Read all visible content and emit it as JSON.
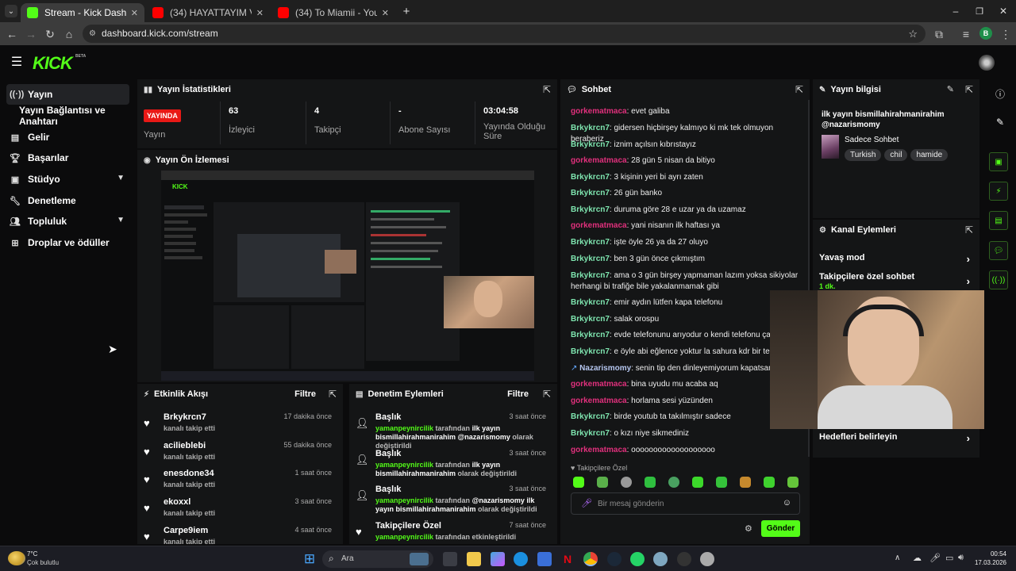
{
  "browser": {
    "tabs": [
      {
        "title": "Stream - Kick Dashboard",
        "fav_color": "#53fc18"
      },
      {
        "title": "(34) HAYATTAYIM VLOG - YouTu",
        "fav_color": "#ff0000"
      },
      {
        "title": "(34) To Miamii - YouTube",
        "fav_color": "#ff0000"
      }
    ],
    "url": "dashboard.kick.com/stream",
    "profile_initial": "B"
  },
  "brand": {
    "logo": "KICK",
    "badge": "BETA"
  },
  "sidebar": {
    "items": [
      {
        "label": "Yayın",
        "icon": "broadcast-icon"
      },
      {
        "label": "Yayın Bağlantısı ve Anahtarı",
        "icon": ""
      },
      {
        "label": "Gelir",
        "icon": "chart-icon"
      },
      {
        "label": "Başarılar",
        "icon": "trophy-icon"
      },
      {
        "label": "Stüdyo",
        "icon": "video-icon"
      },
      {
        "label": "Denetleme",
        "icon": "wrench-icon"
      },
      {
        "label": "Topluluk",
        "icon": "people-icon"
      },
      {
        "label": "Droplar ve ödüller",
        "icon": "gift-icon"
      }
    ]
  },
  "stats": {
    "title": "Yayın İstatistikleri",
    "live_badge": "YAYINDA",
    "live_label": "Yayın",
    "items": [
      {
        "value": "63",
        "label": "İzleyici"
      },
      {
        "value": "4",
        "label": "Takipçi"
      },
      {
        "value": "-",
        "label": "Abone Sayısı"
      },
      {
        "value": "03:04:58",
        "label": "Yayında Olduğu Süre"
      }
    ]
  },
  "preview": {
    "title": "Yayın Ön İzlemesi"
  },
  "activity": {
    "title": "Etkinlik Akışı",
    "filter": "Filtre",
    "items": [
      {
        "name": "Brkykrcn7",
        "sub": "kanalı takip etti",
        "time": "17 dakika önce"
      },
      {
        "name": "acilieblebi",
        "sub": "kanalı takip etti",
        "time": "55 dakika önce"
      },
      {
        "name": "enesdone34",
        "sub": "kanalı takip etti",
        "time": "1 saat önce"
      },
      {
        "name": "ekoxxl",
        "sub": "kanalı takip etti",
        "time": "3 saat önce"
      },
      {
        "name": "Carpe9iem",
        "sub": "kanalı takip etti",
        "time": "4 saat önce"
      }
    ]
  },
  "moderation": {
    "title": "Denetim Eylemleri",
    "filter": "Filtre",
    "items": [
      {
        "name": "Başlık",
        "actor": "yamanpeynircilik",
        "mid": " tarafından ",
        "text": "ilk yayın bismillahirahmanirahim @nazarismomy",
        "end": " olarak değiştirildi",
        "time": "3 saat önce"
      },
      {
        "name": "Başlık",
        "actor": "yamanpeynircilik",
        "mid": " tarafından ",
        "text": "ilk yayın bismillahirahmanirahim",
        "end": " olarak değiştirildi",
        "time": "3 saat önce"
      },
      {
        "name": "Başlık",
        "actor": "yamanpeynircilik",
        "mid": " tarafından ",
        "text": "@nazarismomy ilk yayın bismillahirahmanirahim",
        "end": " olarak değiştirildi",
        "time": "3 saat önce"
      },
      {
        "name": "Takipçilere Özel",
        "actor": "yamanpeynircilik",
        "mid": " tarafından etkinleştirildi",
        "text": "",
        "end": "",
        "time": "7 saat önce"
      }
    ]
  },
  "chat": {
    "title": "Sohbet",
    "messages": [
      {
        "user": "gorkematmaca",
        "ucls": "u2",
        "text": "evet galiba"
      },
      {
        "user": "Brkykrcn7",
        "ucls": "u1",
        "text": "gidersen hiçbirşey kalmıyo ki mk tek olmuyon beraberiz"
      },
      {
        "user": "Brkykrcn7",
        "ucls": "u1",
        "text": "iznim açılsın kıbrıstayız"
      },
      {
        "user": "gorkematmaca",
        "ucls": "u2",
        "text": "28 gün 5 nisan da bitiyo"
      },
      {
        "user": "Brkykrcn7",
        "ucls": "u1",
        "text": "3 kişinin yeri bi ayrı zaten"
      },
      {
        "user": "Brkykrcn7",
        "ucls": "u1",
        "text": "26 gün banko"
      },
      {
        "user": "Brkykrcn7",
        "ucls": "u1",
        "text": "duruma göre 28 e uzar ya da uzamaz"
      },
      {
        "user": "gorkematmaca",
        "ucls": "u2",
        "text": "yani nisanın ilk haftası ya"
      },
      {
        "user": "Brkykrcn7",
        "ucls": "u1",
        "text": "işte öyle 26 ya da 27 oluyo"
      },
      {
        "user": "Brkykrcn7",
        "ucls": "u1",
        "text": "ben 3 gün önce çıkmıştım"
      },
      {
        "user": "Brkykrcn7",
        "ucls": "u1",
        "text": "ama o 3 gün birşey yapmaman lazım yoksa sikiyolar herhangi bi trafiğe bile yakalanmamak gibi"
      },
      {
        "user": "Brkykrcn7",
        "ucls": "u1",
        "text": "emir aydın lütfen kapa telefonu"
      },
      {
        "user": "Brkykrcn7",
        "ucls": "u1",
        "text": "salak orospu"
      },
      {
        "user": "Brkykrcn7",
        "ucls": "u1",
        "text": "evde telefonunu arıyodur o kendi telefonu çaldı sa"
      },
      {
        "user": "Brkykrcn7",
        "ucls": "u1",
        "text": "e öyle abi eğlence yoktur la sahura kdr bir tek zev"
      },
      {
        "user": "Nazarismomy",
        "ucls": "u3",
        "text": "senin tip den dinleyemiyorum kapatsana k"
      },
      {
        "user": "gorkematmaca",
        "ucls": "u2",
        "text": "bina uyudu mu acaba aq"
      },
      {
        "user": "gorkematmaca",
        "ucls": "u2",
        "text": "horlama sesi yüzünden"
      },
      {
        "user": "Brkykrcn7",
        "ucls": "u1",
        "text": "birde youtub ta takılmıştır sadece"
      },
      {
        "user": "Brkykrcn7",
        "ucls": "u1",
        "text": "o kızı niye sikmediniz"
      },
      {
        "user": "gorkematmaca",
        "ucls": "u2",
        "text": "ooooooooooooooooooo"
      }
    ],
    "followers_only": "Takipçilere Özel",
    "input_placeholder": "Bir mesaj gönderin",
    "send": "Gönder"
  },
  "stream_info": {
    "title": "Yayın bilgisi",
    "stream_title": "ilk yayın bismillahirahmanirahim @nazarismomy",
    "category": "Sadece Sohbet",
    "tags": [
      "Turkish",
      "chil",
      "hamide"
    ]
  },
  "channel_actions": {
    "title": "Kanal Eylemleri",
    "rows": [
      {
        "label": "Yavaş mod",
        "sub": ""
      },
      {
        "label": "Takipçilere özel sohbet",
        "sub": "1 dk."
      },
      {
        "label": "Hedefleri belirleyin",
        "sub": ""
      }
    ]
  },
  "taskbar": {
    "weather_temp": "7°C",
    "weather_desc": "Çok bulutlu",
    "search": "Ara",
    "time": "00:54",
    "date": "17.03.2026"
  }
}
